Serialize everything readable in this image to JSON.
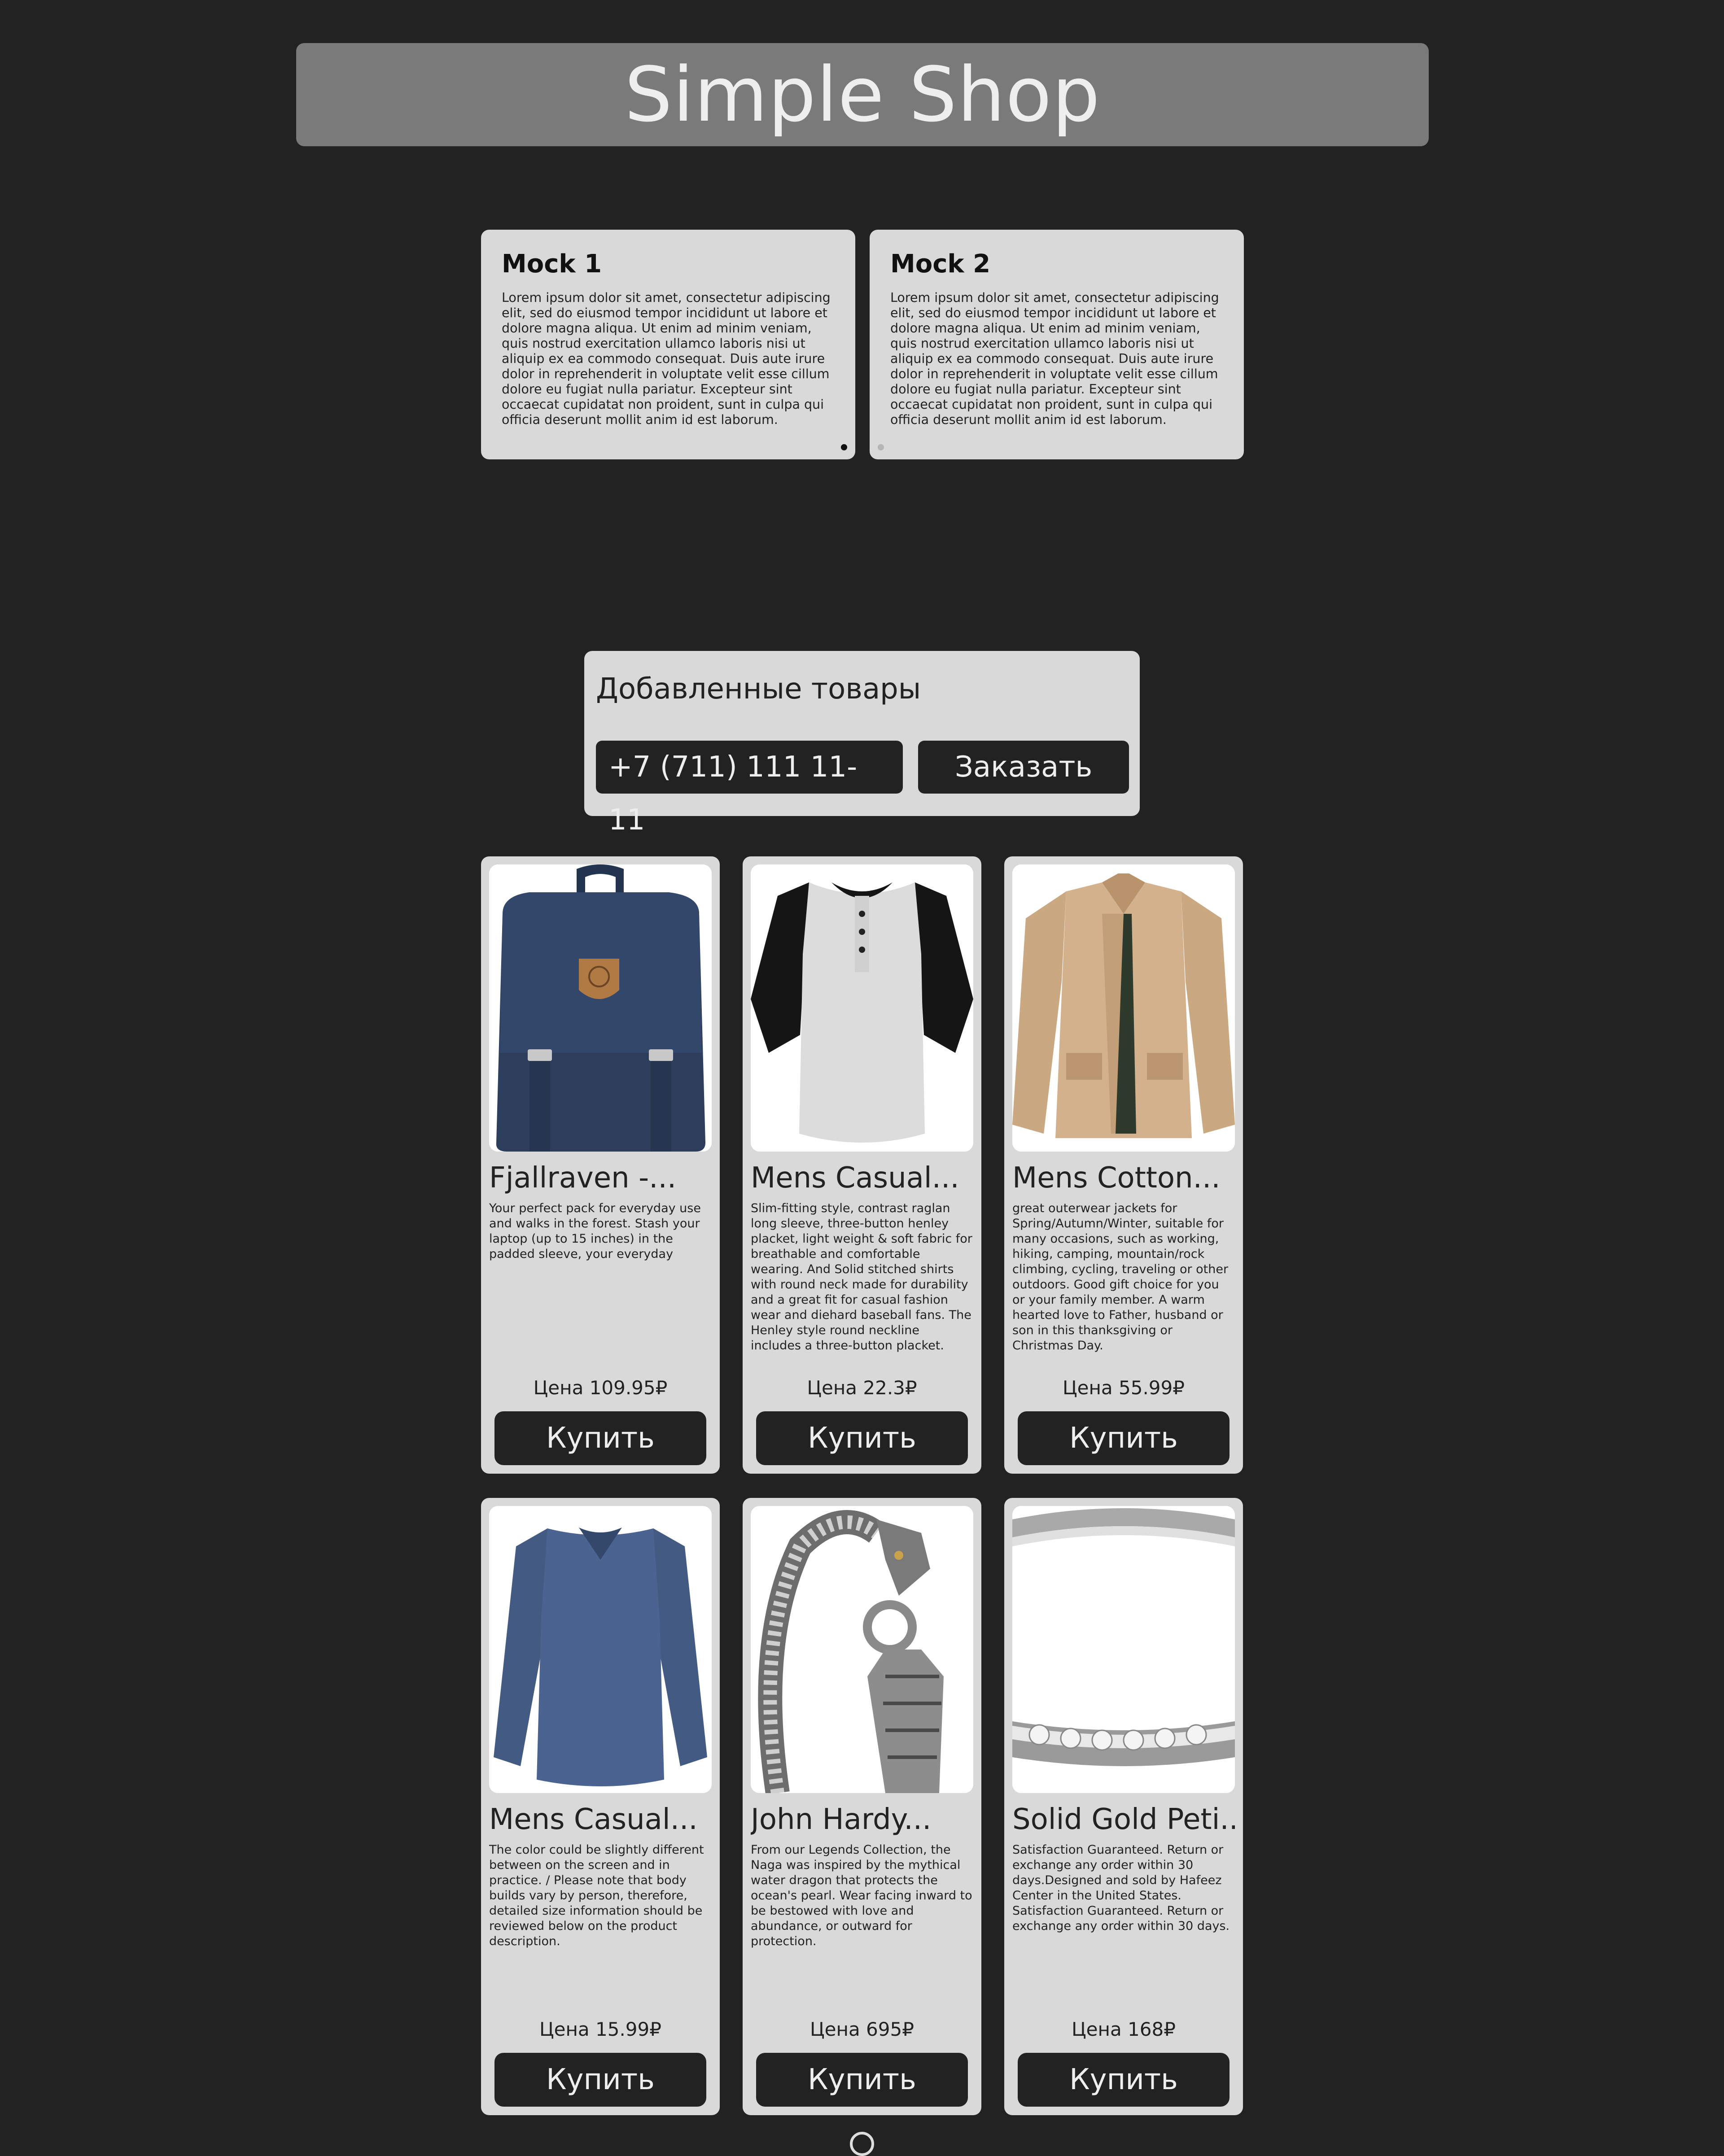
{
  "header": {
    "title": "Simple Shop"
  },
  "mocks": [
    {
      "title": "Mock 1",
      "text": "Lorem ipsum dolor sit amet, consectetur adipiscing elit, sed do eiusmod tempor incididunt ut labore et dolore magna aliqua. Ut enim ad minim veniam, quis nostrud exercitation ullamco laboris nisi ut aliquip ex ea commodo consequat. Duis aute irure dolor in reprehenderit in voluptate velit esse cillum dolore eu fugiat nulla pariatur. Excepteur sint occaecat cupidatat non proident, sunt in culpa qui officia deserunt mollit anim id est laborum."
    },
    {
      "title": "Mock 2",
      "text": "Lorem ipsum dolor sit amet, consectetur adipiscing elit, sed do eiusmod tempor incididunt ut labore et dolore magna aliqua. Ut enim ad minim veniam, quis nostrud exercitation ullamco laboris nisi ut aliquip ex ea commodo consequat. Duis aute irure dolor in reprehenderit in voluptate velit esse cillum dolore eu fugiat nulla pariatur. Excepteur sint occaecat cupidatat non proident, sunt in culpa qui officia deserunt mollit anim id est laborum."
    }
  ],
  "order": {
    "title": "Добавленные товары",
    "phone_value": "+7 (711) 111 11-11",
    "order_button": "Заказать"
  },
  "products": [
    {
      "name": "Fjallraven -...",
      "description": "Your perfect pack for everyday use and walks in the forest. Stash your laptop (up to 15 inches) in the padded sleeve, your everyday",
      "price": "Цена 109.95₽",
      "buy_label": "Купить",
      "image_icon": "backpack-icon"
    },
    {
      "name": "Mens Casual...",
      "description": "Slim-fitting style, contrast raglan long sleeve, three-button henley placket, light weight & soft fabric for breathable and comfortable wearing. And Solid stitched shirts with round neck made for durability and a great fit for casual fashion wear and diehard baseball fans. The Henley style round neckline includes a three-button placket.",
      "price": "Цена 22.3₽",
      "buy_label": "Купить",
      "image_icon": "henley-shirt-icon"
    },
    {
      "name": "Mens Cotton...",
      "description": "great outerwear jackets for Spring/Autumn/Winter, suitable for many occasions, such as working, hiking, camping, mountain/rock climbing, cycling, traveling or other outdoors. Good gift choice for you or your family member. A warm hearted love to Father, husband or son in this thanksgiving or Christmas Day.",
      "price": "Цена 55.99₽",
      "buy_label": "Купить",
      "image_icon": "jacket-icon"
    },
    {
      "name": "Mens Casual...",
      "description": "The color could be slightly different between on the screen and in practice. / Please note that body builds vary by person, therefore, detailed size information should be reviewed below on the product description.",
      "price": "Цена 15.99₽",
      "buy_label": "Купить",
      "image_icon": "long-sleeve-shirt-icon"
    },
    {
      "name": "John Hardy...",
      "description": "From our Legends Collection, the Naga was inspired by the mythical water dragon that protects the ocean's pearl. Wear facing inward to be bestowed with love and abundance, or outward for protection.",
      "price": "Цена 695₽",
      "buy_label": "Купить",
      "image_icon": "bracelet-icon"
    },
    {
      "name": "Solid Gold Peti...",
      "description": "Satisfaction Guaranteed. Return or exchange any order within 30 days.Designed and sold by Hafeez Center in the United States. Satisfaction Guaranteed. Return or exchange any order within 30 days.",
      "price": "Цена 168₽",
      "buy_label": "Купить",
      "image_icon": "ring-icon"
    }
  ],
  "colors": {
    "background": "#222222",
    "card": "#d9d9d9",
    "header": "#7a7a7a",
    "button": "#222222",
    "button_text": "#eeeeee"
  }
}
